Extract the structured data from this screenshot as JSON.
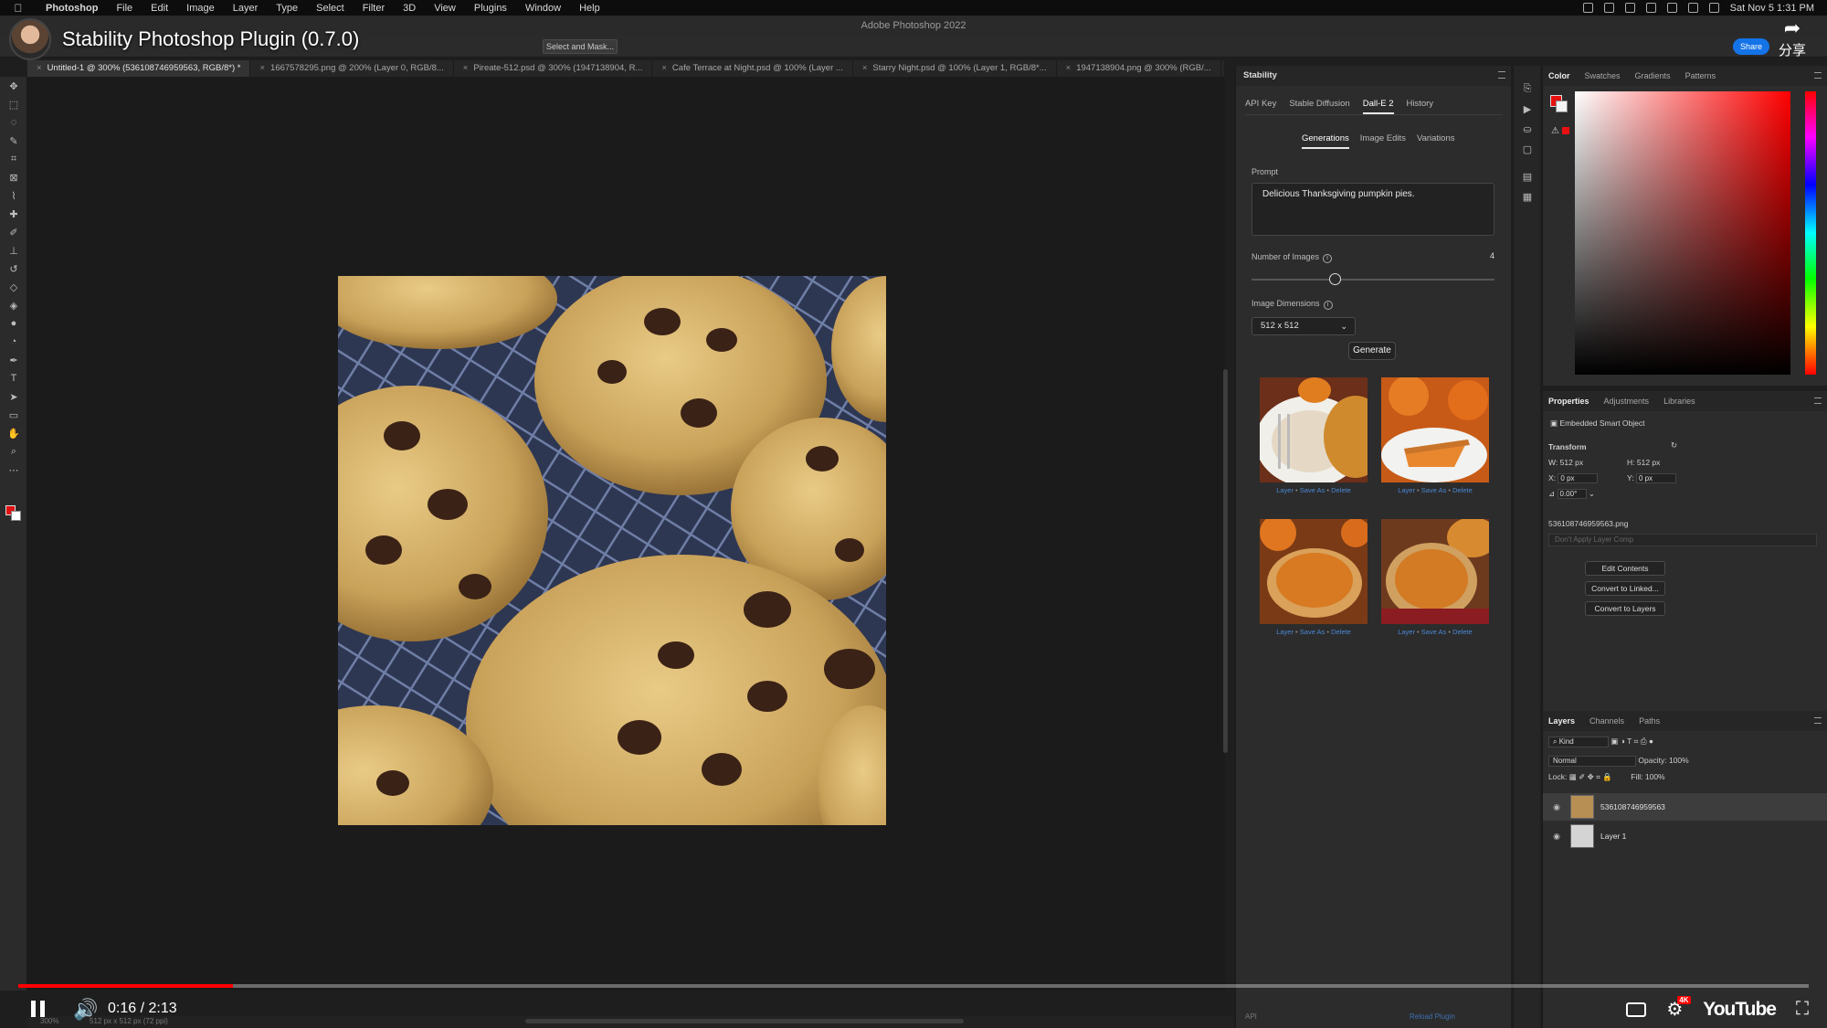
{
  "menubar": {
    "app_name": "Photoshop",
    "items": [
      "File",
      "Edit",
      "Image",
      "Layer",
      "Type",
      "Select",
      "Filter",
      "3D",
      "View",
      "Plugins",
      "Window",
      "Help"
    ],
    "datetime": "Sat Nov 5  1:31 PM"
  },
  "app_title": "Adobe Photoshop 2022",
  "options_bar": {
    "select_mask": "Select and Mask...",
    "share": "Share"
  },
  "video": {
    "title": "Stability Photoshop Plugin (0.7.0)",
    "share_label": "分享",
    "current_time": "0:16",
    "duration": "2:13",
    "time_display": "0:16 / 2:13",
    "progress_fraction": 0.12,
    "quality_badge": "4K",
    "logo": "YouTube"
  },
  "document_tabs": [
    "Untitled-1 @ 300% (536108746959563, RGB/8*) *",
    "1667578295.png @ 200% (Layer 0, RGB/8...",
    "Pireate-512.psd @ 300% (1947138904, R...",
    "Cafe Terrace at Night.psd @ 100% (Layer ...",
    "Starry Night.psd @ 100% (Layer 1, RGB/8*...",
    "1947138904.png @ 300% (RGB/..."
  ],
  "plugin": {
    "panel_title": "Stability",
    "tabs": [
      "API Key",
      "Stable Diffusion",
      "Dall-E 2",
      "History"
    ],
    "active_tab": "Dall-E 2",
    "subtabs": [
      "Generations",
      "Image Edits",
      "Variations"
    ],
    "active_subtab": "Generations",
    "prompt_label": "Prompt",
    "prompt_value": "Delicious Thanksgiving pumpkin pies.",
    "num_images_label": "Number of Images",
    "num_images_value": "4",
    "image_dimensions_label": "Image Dimensions",
    "image_dimensions_value": "512 x 512",
    "generate_label": "Generate",
    "link_layer": "Layer",
    "link_save_as": "Save As",
    "link_delete": "Delete",
    "footer_api": "API",
    "footer_reload": "Reload Plugin"
  },
  "color_panel": {
    "tabs": [
      "Color",
      "Swatches",
      "Gradients",
      "Patterns"
    ],
    "foreground": "#e81010",
    "background": "#f4f4f4"
  },
  "properties_panel": {
    "tabs": [
      "Properties",
      "Adjustments",
      "Libraries"
    ],
    "object_type": "Embedded Smart Object",
    "transform_label": "Transform",
    "w_label": "W:",
    "w_value": "512 px",
    "h_label": "H:",
    "h_value": "512 px",
    "x_label": "X:",
    "x_value": "0 px",
    "y_label": "Y:",
    "y_value": "0 px",
    "angle_value": "0.00°",
    "filename": "536108746959563.png",
    "layer_comp": "Don't Apply Layer Comp",
    "btn_edit": "Edit Contents",
    "btn_convert_linked": "Convert to Linked...",
    "btn_convert_layers": "Convert to Layers"
  },
  "layers_panel": {
    "tabs": [
      "Layers",
      "Channels",
      "Paths"
    ],
    "kind": "Kind",
    "blend_mode": "Normal",
    "opacity_label": "Opacity:",
    "opacity_value": "100%",
    "lock_label": "Lock:",
    "fill_label": "Fill:",
    "fill_value": "100%",
    "layers": [
      "536108746959563",
      "Layer 1"
    ]
  },
  "status": {
    "zoom": "300%",
    "doc_info": "512 px x 512 px (72 ppi)"
  }
}
